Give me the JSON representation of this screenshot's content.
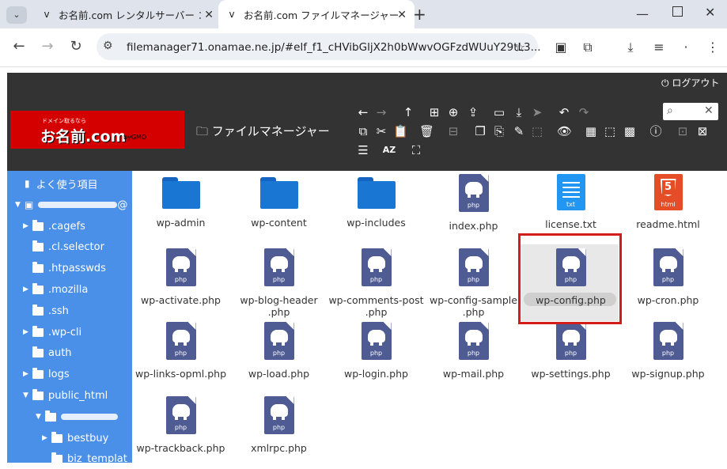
{
  "browser": {
    "tabs": [
      {
        "label": "お名前.com レンタルサーバー コントロ",
        "active": false
      },
      {
        "label": "お名前.com ファイルマネージャー",
        "active": true
      }
    ],
    "new_tab": "+",
    "url": "filemanager71.onamae.ne.jp/#elf_f1_cHVibGljX2h0bWwvOGFzdWUuY29tL3...",
    "window_controls": [
      "minimize",
      "maximize",
      "close"
    ]
  },
  "fm": {
    "logout": "ログアウト",
    "logo": {
      "tagline": "ドメイン取るなら",
      "brand": "お名前.com",
      "sub": ".com .jp .co.jp",
      "gmo": "byGMO"
    },
    "title": "ファイルマネージャー",
    "search_placeholder": ""
  },
  "sidebar": {
    "items": [
      {
        "label": "よく使う項目",
        "indent": 0,
        "arrow": false,
        "icon": "bookmark"
      },
      {
        "label": "",
        "indent": 0,
        "arrow": "down",
        "icon": "drive",
        "blurred": true,
        "suffix": "@"
      },
      {
        "label": ".cagefs",
        "indent": 1,
        "arrow": "right"
      },
      {
        "label": ".cl.selector",
        "indent": 1,
        "arrow": false
      },
      {
        "label": ".htpasswds",
        "indent": 1,
        "arrow": false
      },
      {
        "label": ".mozilla",
        "indent": 1,
        "arrow": "right"
      },
      {
        "label": ".ssh",
        "indent": 1,
        "arrow": false
      },
      {
        "label": ".wp-cli",
        "indent": 1,
        "arrow": "right"
      },
      {
        "label": "auth",
        "indent": 1,
        "arrow": false
      },
      {
        "label": "logs",
        "indent": 1,
        "arrow": "right"
      },
      {
        "label": "public_html",
        "indent": 1,
        "arrow": "down"
      },
      {
        "label": "",
        "indent": 2,
        "arrow": "down",
        "blurred": true
      },
      {
        "label": "bestbuy",
        "indent": 3,
        "arrow": "right"
      },
      {
        "label": "biz_templat",
        "indent": 3,
        "arrow": false
      }
    ]
  },
  "files": [
    {
      "name": "wp-admin",
      "type": "folder"
    },
    {
      "name": "wp-content",
      "type": "folder"
    },
    {
      "name": "wp-includes",
      "type": "folder"
    },
    {
      "name": "index.php",
      "type": "php"
    },
    {
      "name": "license.txt",
      "type": "txt"
    },
    {
      "name": "readme.html",
      "type": "html"
    },
    {
      "name": "wp-activate.php",
      "type": "php"
    },
    {
      "name": "wp-blog-header\n.php",
      "type": "php"
    },
    {
      "name": "wp-comments-post\n.php",
      "type": "php"
    },
    {
      "name": "wp-config-sample\n.php",
      "type": "php"
    },
    {
      "name": "wp-config.php",
      "type": "php",
      "selected": true
    },
    {
      "name": "wp-cron.php",
      "type": "php"
    },
    {
      "name": "wp-links-opml.php",
      "type": "php"
    },
    {
      "name": "wp-load.php",
      "type": "php"
    },
    {
      "name": "wp-login.php",
      "type": "php"
    },
    {
      "name": "wp-mail.php",
      "type": "php"
    },
    {
      "name": "wp-settings.php",
      "type": "php"
    },
    {
      "name": "wp-signup.php",
      "type": "php"
    },
    {
      "name": "wp-trackback.php",
      "type": "php"
    },
    {
      "name": "xmlrpc.php",
      "type": "php"
    }
  ],
  "icon_labels": {
    "php": "php",
    "txt": "txt",
    "html": "html"
  },
  "colors": {
    "php": "#4f5b93",
    "folder": "#1976d2",
    "sidebar": "#4a8fe8",
    "toolbar": "#333333",
    "highlight": "#d31d1d",
    "logo": "#d40000"
  }
}
